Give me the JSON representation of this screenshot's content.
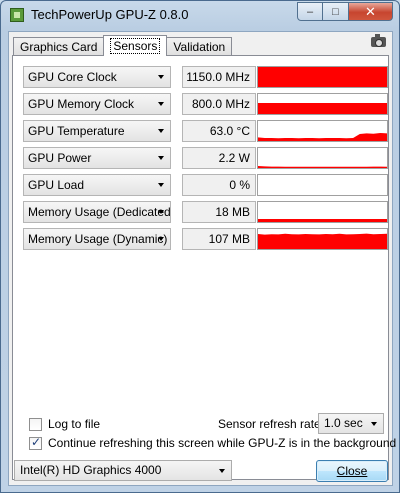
{
  "window": {
    "title": "TechPowerUp GPU-Z 0.8.0",
    "minimize_glyph": "–",
    "maximize_glyph": "□",
    "close_glyph": "✕"
  },
  "tabs": [
    {
      "label": "Graphics Card"
    },
    {
      "label": "Sensors"
    },
    {
      "label": "Validation"
    }
  ],
  "sensors": [
    {
      "label": "GPU Core Clock",
      "value": "1150.0 MHz",
      "history": [
        1,
        1,
        1,
        1,
        1,
        1,
        1,
        1,
        1,
        1,
        1,
        1,
        1,
        1,
        1,
        1,
        1,
        1,
        1,
        1
      ]
    },
    {
      "label": "GPU Memory Clock",
      "value": "800.0 MHz",
      "history": [
        0.55,
        0.55,
        0.55,
        0.55,
        0.55,
        0.55,
        0.55,
        0.55,
        0.55,
        0.55,
        0.55,
        0.55,
        0.55,
        0.55,
        0.55,
        0.55,
        0.55,
        0.55,
        0.55,
        0.55
      ]
    },
    {
      "label": "GPU Temperature",
      "value": "63.0 °C",
      "history": [
        0.18,
        0.15,
        0.15,
        0.14,
        0.15,
        0.15,
        0.14,
        0.15,
        0.15,
        0.14,
        0.15,
        0.15,
        0.15,
        0.14,
        0.15,
        0.35,
        0.38,
        0.36,
        0.4,
        0.38
      ]
    },
    {
      "label": "GPU Power",
      "value": "2.2 W",
      "history": [
        0.1,
        0.08,
        0.07,
        0.07,
        0.06,
        0.06,
        0.06,
        0.06,
        0.06,
        0.06,
        0.06,
        0.06,
        0.06,
        0.06,
        0.06,
        0.06,
        0.06,
        0.07,
        0.07,
        0.06
      ]
    },
    {
      "label": "GPU Load",
      "value": "0 %",
      "history": [
        0,
        0,
        0,
        0,
        0,
        0,
        0,
        0,
        0,
        0,
        0,
        0,
        0,
        0,
        0,
        0,
        0,
        0,
        0,
        0
      ]
    },
    {
      "label": "Memory Usage (Dedicated)",
      "value": "18 MB",
      "history": [
        0.15,
        0.15,
        0.15,
        0.15,
        0.15,
        0.15,
        0.15,
        0.15,
        0.15,
        0.15,
        0.15,
        0.15,
        0.15,
        0.15,
        0.15,
        0.15,
        0.15,
        0.15,
        0.15,
        0.15
      ]
    },
    {
      "label": "Memory Usage (Dynamic)",
      "value": "107 MB",
      "history": [
        0.75,
        0.72,
        0.74,
        0.73,
        0.76,
        0.74,
        0.73,
        0.75,
        0.74,
        0.73,
        0.75,
        0.74,
        0.76,
        0.73,
        0.74,
        0.75,
        0.77,
        0.74,
        0.75,
        0.76
      ]
    }
  ],
  "colors": {
    "graph_fill": "#ff0000"
  },
  "footer": {
    "log_label": "Log to file",
    "log_checked": false,
    "refresh_label": "Sensor refresh rate:",
    "refresh_value": "1.0 sec",
    "continue_label": "Continue refreshing this screen while GPU-Z is in the background",
    "continue_checked": true,
    "gpu_select": "Intel(R) HD Graphics 4000",
    "close_button": "Close"
  }
}
